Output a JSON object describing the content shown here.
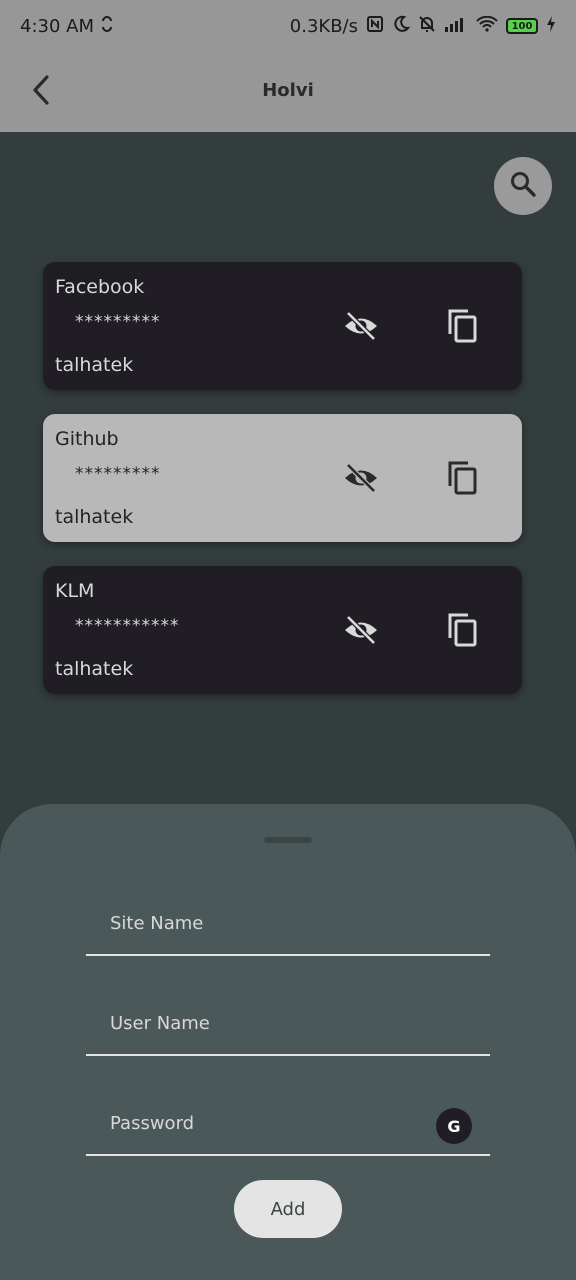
{
  "status_bar": {
    "time": "4:30 AM",
    "speed": "0.3KB/s",
    "battery": "100"
  },
  "app_bar": {
    "title": "Holvi"
  },
  "entries": [
    {
      "site": "Facebook",
      "password_masked": "*********",
      "username": "talhatek"
    },
    {
      "site": "Github",
      "password_masked": "*********",
      "username": "talhatek"
    },
    {
      "site": "KLM",
      "password_masked": "***********",
      "username": "talhatek"
    }
  ],
  "form": {
    "site_placeholder": "Site Name",
    "user_placeholder": "User Name",
    "password_placeholder": "Password",
    "generate_label": "G",
    "add_label": "Add"
  },
  "colors": {
    "background": "#333d3e",
    "app_bar": "#979797",
    "card_dark": "#201e24",
    "card_light": "#b8b8b8",
    "sheet": "#4b5859"
  }
}
